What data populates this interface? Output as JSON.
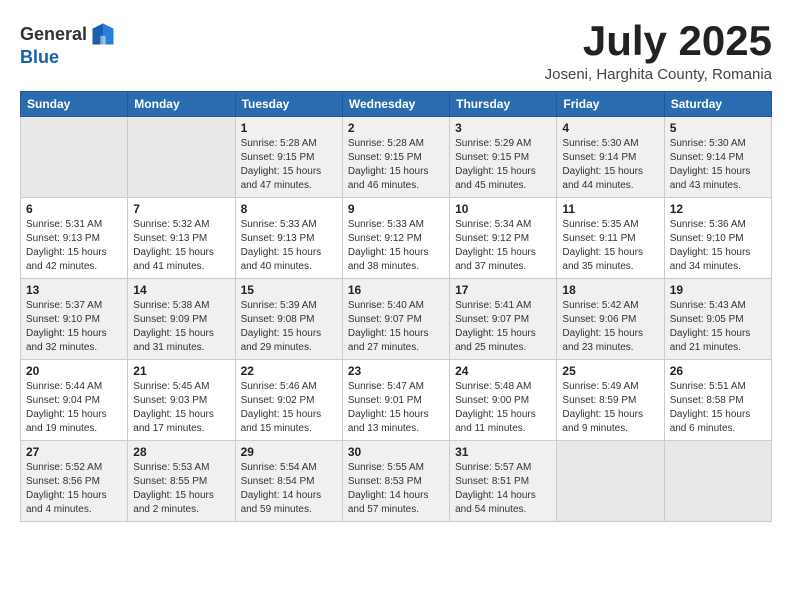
{
  "logo": {
    "general": "General",
    "blue": "Blue"
  },
  "title": "July 2025",
  "location": "Joseni, Harghita County, Romania",
  "days_of_week": [
    "Sunday",
    "Monday",
    "Tuesday",
    "Wednesday",
    "Thursday",
    "Friday",
    "Saturday"
  ],
  "weeks": [
    [
      {
        "day": "",
        "details": ""
      },
      {
        "day": "",
        "details": ""
      },
      {
        "day": "1",
        "details": "Sunrise: 5:28 AM\nSunset: 9:15 PM\nDaylight: 15 hours and 47 minutes."
      },
      {
        "day": "2",
        "details": "Sunrise: 5:28 AM\nSunset: 9:15 PM\nDaylight: 15 hours and 46 minutes."
      },
      {
        "day": "3",
        "details": "Sunrise: 5:29 AM\nSunset: 9:15 PM\nDaylight: 15 hours and 45 minutes."
      },
      {
        "day": "4",
        "details": "Sunrise: 5:30 AM\nSunset: 9:14 PM\nDaylight: 15 hours and 44 minutes."
      },
      {
        "day": "5",
        "details": "Sunrise: 5:30 AM\nSunset: 9:14 PM\nDaylight: 15 hours and 43 minutes."
      }
    ],
    [
      {
        "day": "6",
        "details": "Sunrise: 5:31 AM\nSunset: 9:13 PM\nDaylight: 15 hours and 42 minutes."
      },
      {
        "day": "7",
        "details": "Sunrise: 5:32 AM\nSunset: 9:13 PM\nDaylight: 15 hours and 41 minutes."
      },
      {
        "day": "8",
        "details": "Sunrise: 5:33 AM\nSunset: 9:13 PM\nDaylight: 15 hours and 40 minutes."
      },
      {
        "day": "9",
        "details": "Sunrise: 5:33 AM\nSunset: 9:12 PM\nDaylight: 15 hours and 38 minutes."
      },
      {
        "day": "10",
        "details": "Sunrise: 5:34 AM\nSunset: 9:12 PM\nDaylight: 15 hours and 37 minutes."
      },
      {
        "day": "11",
        "details": "Sunrise: 5:35 AM\nSunset: 9:11 PM\nDaylight: 15 hours and 35 minutes."
      },
      {
        "day": "12",
        "details": "Sunrise: 5:36 AM\nSunset: 9:10 PM\nDaylight: 15 hours and 34 minutes."
      }
    ],
    [
      {
        "day": "13",
        "details": "Sunrise: 5:37 AM\nSunset: 9:10 PM\nDaylight: 15 hours and 32 minutes."
      },
      {
        "day": "14",
        "details": "Sunrise: 5:38 AM\nSunset: 9:09 PM\nDaylight: 15 hours and 31 minutes."
      },
      {
        "day": "15",
        "details": "Sunrise: 5:39 AM\nSunset: 9:08 PM\nDaylight: 15 hours and 29 minutes."
      },
      {
        "day": "16",
        "details": "Sunrise: 5:40 AM\nSunset: 9:07 PM\nDaylight: 15 hours and 27 minutes."
      },
      {
        "day": "17",
        "details": "Sunrise: 5:41 AM\nSunset: 9:07 PM\nDaylight: 15 hours and 25 minutes."
      },
      {
        "day": "18",
        "details": "Sunrise: 5:42 AM\nSunset: 9:06 PM\nDaylight: 15 hours and 23 minutes."
      },
      {
        "day": "19",
        "details": "Sunrise: 5:43 AM\nSunset: 9:05 PM\nDaylight: 15 hours and 21 minutes."
      }
    ],
    [
      {
        "day": "20",
        "details": "Sunrise: 5:44 AM\nSunset: 9:04 PM\nDaylight: 15 hours and 19 minutes."
      },
      {
        "day": "21",
        "details": "Sunrise: 5:45 AM\nSunset: 9:03 PM\nDaylight: 15 hours and 17 minutes."
      },
      {
        "day": "22",
        "details": "Sunrise: 5:46 AM\nSunset: 9:02 PM\nDaylight: 15 hours and 15 minutes."
      },
      {
        "day": "23",
        "details": "Sunrise: 5:47 AM\nSunset: 9:01 PM\nDaylight: 15 hours and 13 minutes."
      },
      {
        "day": "24",
        "details": "Sunrise: 5:48 AM\nSunset: 9:00 PM\nDaylight: 15 hours and 11 minutes."
      },
      {
        "day": "25",
        "details": "Sunrise: 5:49 AM\nSunset: 8:59 PM\nDaylight: 15 hours and 9 minutes."
      },
      {
        "day": "26",
        "details": "Sunrise: 5:51 AM\nSunset: 8:58 PM\nDaylight: 15 hours and 6 minutes."
      }
    ],
    [
      {
        "day": "27",
        "details": "Sunrise: 5:52 AM\nSunset: 8:56 PM\nDaylight: 15 hours and 4 minutes."
      },
      {
        "day": "28",
        "details": "Sunrise: 5:53 AM\nSunset: 8:55 PM\nDaylight: 15 hours and 2 minutes."
      },
      {
        "day": "29",
        "details": "Sunrise: 5:54 AM\nSunset: 8:54 PM\nDaylight: 14 hours and 59 minutes."
      },
      {
        "day": "30",
        "details": "Sunrise: 5:55 AM\nSunset: 8:53 PM\nDaylight: 14 hours and 57 minutes."
      },
      {
        "day": "31",
        "details": "Sunrise: 5:57 AM\nSunset: 8:51 PM\nDaylight: 14 hours and 54 minutes."
      },
      {
        "day": "",
        "details": ""
      },
      {
        "day": "",
        "details": ""
      }
    ]
  ]
}
